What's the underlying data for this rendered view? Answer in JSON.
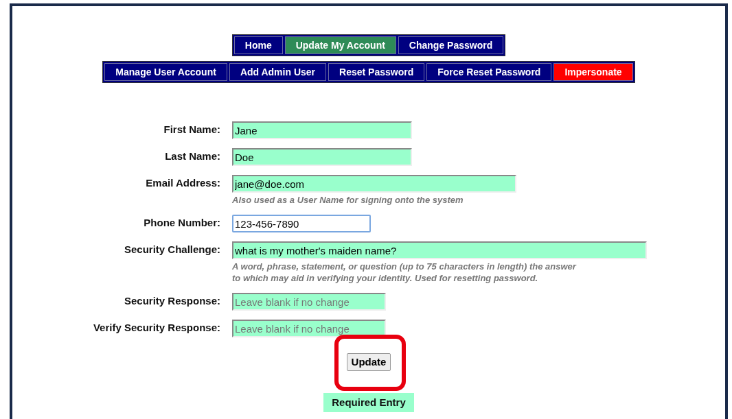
{
  "nav_primary": [
    {
      "label": "Home",
      "selected": false
    },
    {
      "label": "Update My Account",
      "selected": true
    },
    {
      "label": "Change Password",
      "selected": false
    }
  ],
  "nav_admin": [
    {
      "label": "Manage User Account",
      "selected": false,
      "kind": "normal"
    },
    {
      "label": "Add Admin User",
      "selected": false,
      "kind": "normal"
    },
    {
      "label": "Reset Password",
      "selected": false,
      "kind": "normal"
    },
    {
      "label": "Force Reset Password",
      "selected": false,
      "kind": "normal"
    },
    {
      "label": "Impersonate",
      "selected": false,
      "kind": "alert"
    }
  ],
  "form": {
    "fields": [
      {
        "label": "First Name:",
        "value": "Jane",
        "required": true,
        "focused": false
      },
      {
        "label": "Last Name:",
        "value": "Doe",
        "required": true,
        "focused": false
      },
      {
        "label": "Email Address:",
        "value": "jane@doe.com",
        "required": true,
        "focused": false,
        "hint": [
          "Also used as a User Name for signing onto the system"
        ]
      },
      {
        "label": "Phone Number:",
        "value": "123-456-7890",
        "required": false,
        "focused": true
      },
      {
        "label": "Security Challenge:",
        "value": "what is my mother's maiden name?",
        "required": true,
        "focused": false,
        "hint": [
          "A word, phrase, statement, or question (up to 75 characters in length) the answer",
          "to which may aid in verifying your identity. Used for resetting password."
        ]
      },
      {
        "label": "Security Response:",
        "placeholder": "Leave blank if no change",
        "required": true,
        "focused": false
      },
      {
        "label": "Verify Security Response:",
        "placeholder": "Leave blank if no change",
        "required": true,
        "focused": false
      }
    ],
    "submit": {
      "label": "Update",
      "highlighted": true
    },
    "legend": {
      "label": "Required Entry"
    }
  }
}
